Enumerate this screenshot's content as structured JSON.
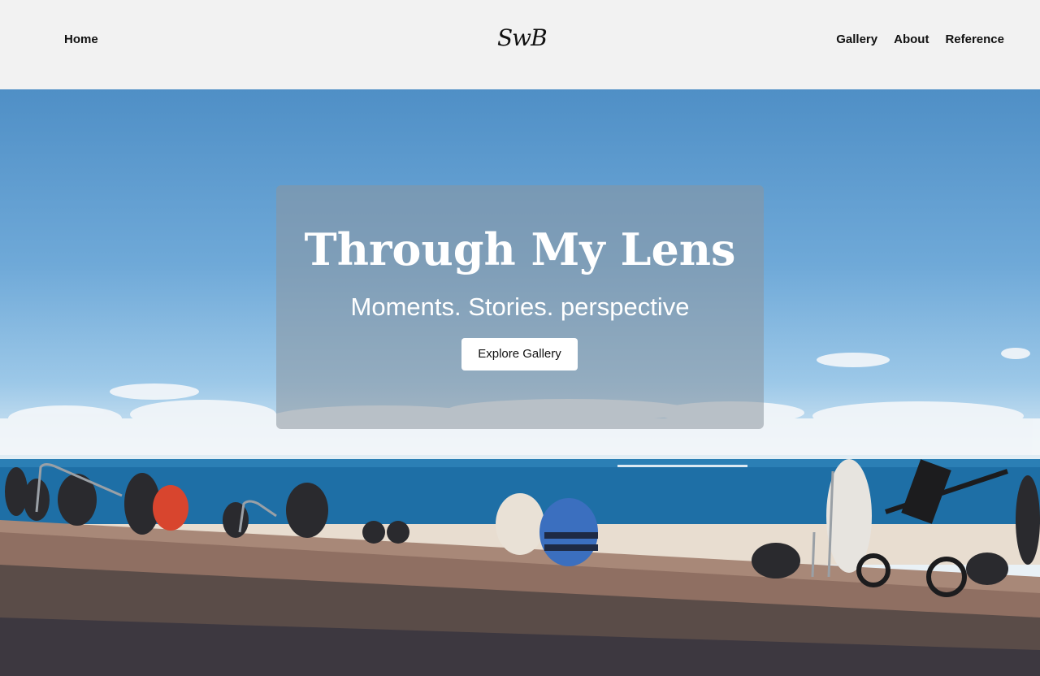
{
  "nav": {
    "left": [
      {
        "label": "Home"
      }
    ],
    "logo": "SwB",
    "right": [
      {
        "label": "Gallery"
      },
      {
        "label": "About"
      },
      {
        "label": "Reference"
      }
    ]
  },
  "hero": {
    "title": "Through My Lens",
    "subtitle": "Moments. Stories. perspective",
    "cta_label": "Explore Gallery"
  }
}
